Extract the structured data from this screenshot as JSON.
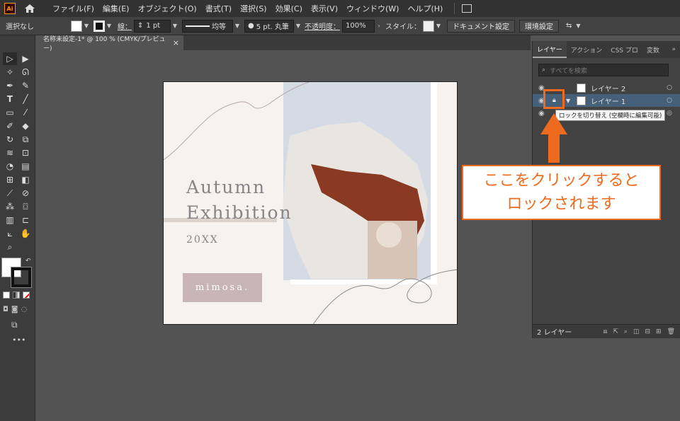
{
  "menubar": {
    "logo": "Ai",
    "items": [
      "ファイル(F)",
      "編集(E)",
      "オブジェクト(O)",
      "書式(T)",
      "選択(S)",
      "効果(C)",
      "表示(V)",
      "ウィンドウ(W)",
      "ヘルプ(H)"
    ]
  },
  "controlbar": {
    "selection_label": "選択なし",
    "stroke_label": "線：",
    "stroke_weight": "1 pt",
    "stroke_profile": "均等",
    "brush": "5 pt. 丸筆",
    "opacity_label": "不透明度：",
    "opacity_value": "100%",
    "style_label": "スタイル：",
    "doc_settings": "ドキュメント設定",
    "preferences": "環境設定"
  },
  "document_tab": {
    "title": "名称未設定-1* @ 100 % (CMYK/プレビュー)",
    "close": "×"
  },
  "artboard": {
    "title_line1": "Autumn",
    "title_line2": "Exhibition",
    "year": "20XX",
    "brand": "mimosa."
  },
  "layers_panel": {
    "tabs": [
      "レイヤー",
      "アクション",
      "CSS プロ",
      "変数"
    ],
    "overflow": "»",
    "search_placeholder": "すべてを検索",
    "layers": [
      {
        "name": "レイヤー 2",
        "selected": false
      },
      {
        "name": "レイヤー 1",
        "selected": true
      }
    ],
    "footer_count": "2 レイヤー"
  },
  "tooltip": "ロックを切り替え (空欄時に編集可能)",
  "callout": {
    "line1": "ここをクリックすると",
    "line2": "ロックされます"
  },
  "colors": {
    "accent": "#ee6a1e",
    "layer_selected": "#46607a",
    "brand_box": "#c9b4b6"
  }
}
